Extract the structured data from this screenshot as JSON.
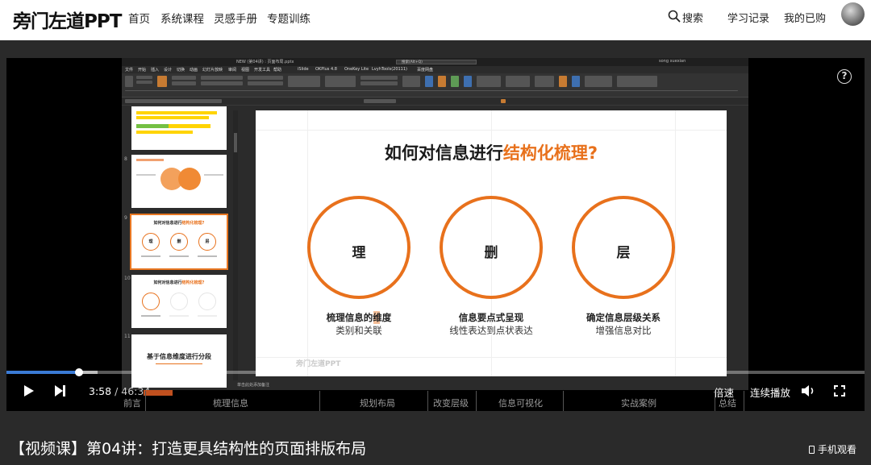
{
  "site": {
    "logo": "旁门左道PPT",
    "nav": [
      "首页",
      "系统课程",
      "灵感手册",
      "专题训练"
    ],
    "search": "搜索",
    "study_record": "学习记录",
    "my_purchased": "我的已购"
  },
  "player": {
    "current_time": "3:58",
    "separator": "/",
    "total_time": "46:34",
    "progress_fraction": 0.085,
    "speed_label": "倍速",
    "autoplay_label": "连续播放",
    "help": "?",
    "chapters": [
      "前言",
      "梳理信息",
      "规划布局",
      "改变层级",
      "信息可视化",
      "实战案例",
      "总结"
    ]
  },
  "ppt": {
    "window_title": "NEW (第04讲) : 页面布局.pptx",
    "search_hint": "搜索(Alt+Q)",
    "user": "song xuexian",
    "tabs": [
      "文件",
      "开始",
      "插入",
      "设计",
      "切换",
      "动画",
      "幻灯片放映",
      "审阅",
      "视图",
      "开发工具",
      "帮助",
      "iSlide",
      "OKPlus 4.8",
      "OneKey Lite",
      "LvyhTools(20111)",
      "百度网盘"
    ],
    "notes_hint": "单击此处添加备注",
    "thumb_numbers": [
      "8",
      "9",
      "10",
      "11"
    ],
    "thumb8_chars": [
      "理",
      "删",
      "层"
    ],
    "thumb11_title": "基于信息维度进行分段",
    "slide": {
      "title_prefix": "如何对信息进行",
      "title_highlight": "结构化梳理?",
      "items": [
        {
          "char": "理",
          "label": "梳理信息的维度",
          "sub": "类别和关联"
        },
        {
          "char": "删",
          "label": "信息要点式呈现",
          "sub": "线性表达到点状表达"
        },
        {
          "char": "层",
          "label": "确定信息层级关系",
          "sub": "增强信息对比"
        }
      ],
      "watermark": "旁门左道PPT"
    }
  },
  "course": {
    "title": "【视频课】第04讲：打造更具结构性的页面排版布局",
    "mobile_watch": "手机观看"
  },
  "colors": {
    "accent_orange": "#e8711c",
    "progress_blue": "#3a7bd5",
    "background": "#2a2a2a"
  }
}
